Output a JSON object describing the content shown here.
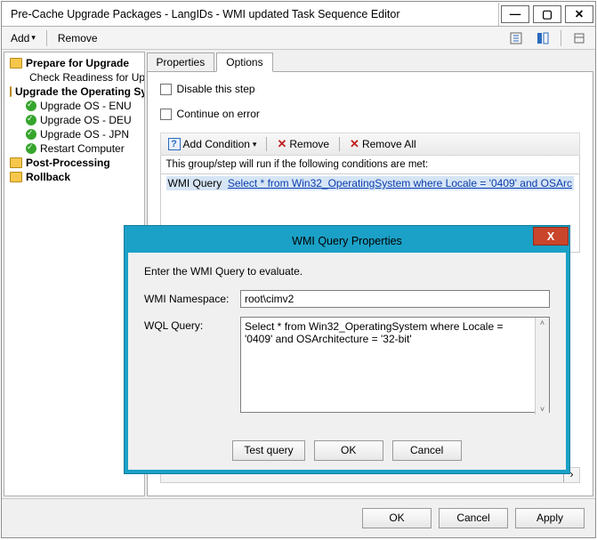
{
  "window": {
    "title": "Pre-Cache Upgrade Packages - LangIDs - WMI updated Task Sequence Editor"
  },
  "toolbar": {
    "add": "Add",
    "remove": "Remove"
  },
  "tree": {
    "nodes": [
      {
        "label": "Prepare for Upgrade",
        "bold": true,
        "folder": true
      },
      {
        "label": "Check Readiness for Upgrade",
        "bold": false,
        "child": true
      },
      {
        "label": "Upgrade the Operating System",
        "bold": true,
        "folder": true
      },
      {
        "label": "Upgrade OS - ENU",
        "bold": false,
        "child": true
      },
      {
        "label": "Upgrade OS - DEU",
        "bold": false,
        "child": true
      },
      {
        "label": "Upgrade OS - JPN",
        "bold": false,
        "child": true
      },
      {
        "label": "Restart Computer",
        "bold": false,
        "child": true
      },
      {
        "label": "Post-Processing",
        "bold": true,
        "folder": true
      },
      {
        "label": "Rollback",
        "bold": true,
        "folder": true
      }
    ]
  },
  "tabs": {
    "properties": "Properties",
    "options": "Options"
  },
  "options": {
    "disable": "Disable this step",
    "continue": "Continue on error",
    "add_condition": "Add Condition",
    "remove": "Remove",
    "remove_all": "Remove All",
    "desc": "This group/step will run if the following conditions are met:",
    "entry_prefix": "WMI Query",
    "entry_link": "Select * from Win32_OperatingSystem where Locale = '0409' and OSArc"
  },
  "footer": {
    "ok": "OK",
    "cancel": "Cancel",
    "apply": "Apply"
  },
  "modal": {
    "title": "WMI Query Properties",
    "intro": "Enter the WMI Query to evaluate.",
    "ns_label": "WMI Namespace:",
    "ns_value": "root\\cimv2",
    "q_label": "WQL Query:",
    "q_value": "Select * from Win32_OperatingSystem where Locale = '0409' and OSArchitecture = '32-bit'",
    "test": "Test query",
    "ok": "OK",
    "cancel": "Cancel"
  }
}
